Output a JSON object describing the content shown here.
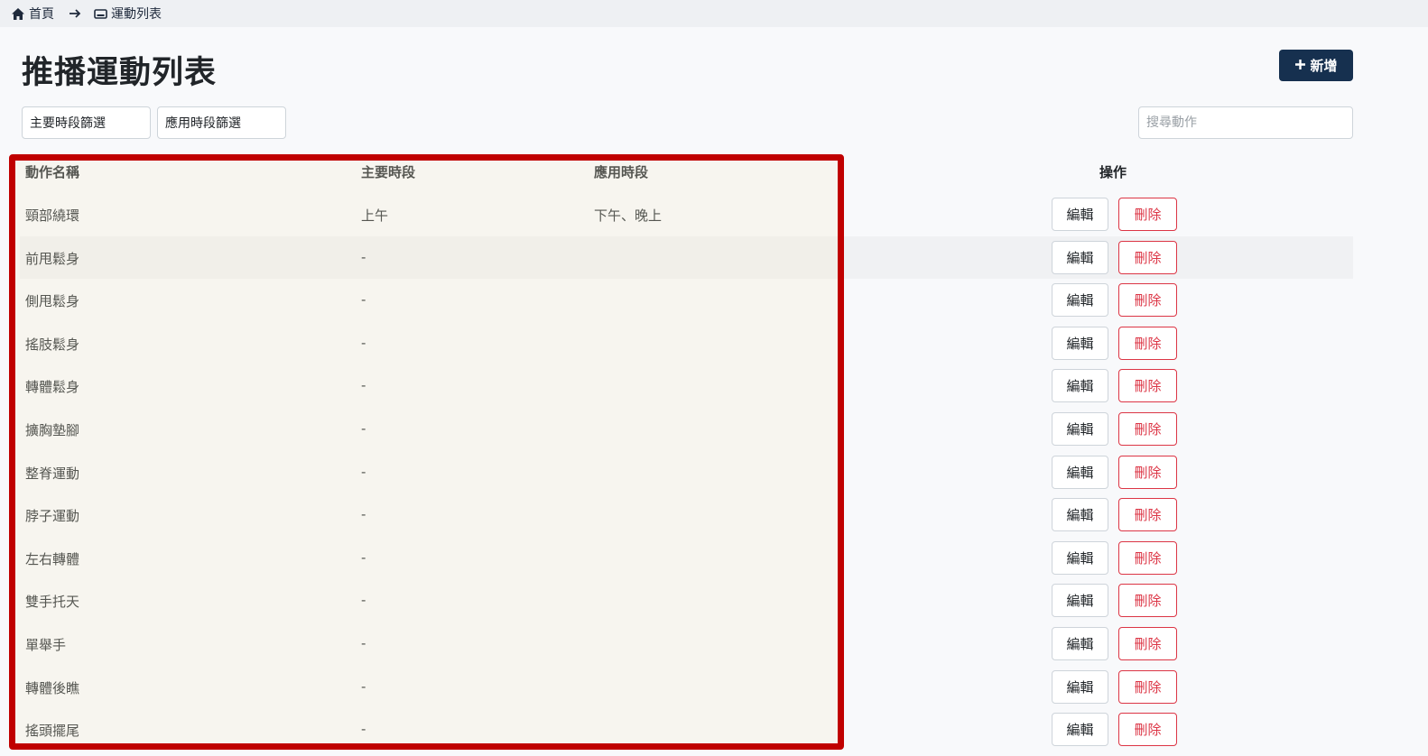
{
  "breadcrumb": {
    "home_label": "首頁",
    "current_label": "運動列表"
  },
  "header": {
    "title": "推播運動列表",
    "add_label": "新增"
  },
  "filters": {
    "main_period": "主要時段篩選",
    "applied_period": "應用時段篩選",
    "search_placeholder": "搜尋動作"
  },
  "table": {
    "columns": {
      "name": "動作名稱",
      "main_period": "主要時段",
      "applied_period": "應用時段",
      "operations": "操作"
    },
    "edit_label": "編輯",
    "delete_label": "刪除",
    "rows": [
      {
        "name": "頸部繞環",
        "main": "上午",
        "applied": "下午、晚上"
      },
      {
        "name": "前甩鬆身",
        "main": "-",
        "applied": ""
      },
      {
        "name": "側甩鬆身",
        "main": "-",
        "applied": ""
      },
      {
        "name": "搖肢鬆身",
        "main": "-",
        "applied": ""
      },
      {
        "name": "轉體鬆身",
        "main": "-",
        "applied": ""
      },
      {
        "name": "擴胸墊腳",
        "main": "-",
        "applied": ""
      },
      {
        "name": "整脊運動",
        "main": "-",
        "applied": ""
      },
      {
        "name": "脖子運動",
        "main": "-",
        "applied": ""
      },
      {
        "name": "左右轉體",
        "main": "-",
        "applied": ""
      },
      {
        "name": "雙手托天",
        "main": "-",
        "applied": ""
      },
      {
        "name": "單舉手",
        "main": "-",
        "applied": ""
      },
      {
        "name": "轉體後瞧",
        "main": "-",
        "applied": ""
      },
      {
        "name": "搖頭擺尾",
        "main": "-",
        "applied": ""
      }
    ]
  },
  "colors": {
    "primary": "#16304f",
    "danger": "#dc3545",
    "highlight": "#c00000"
  }
}
